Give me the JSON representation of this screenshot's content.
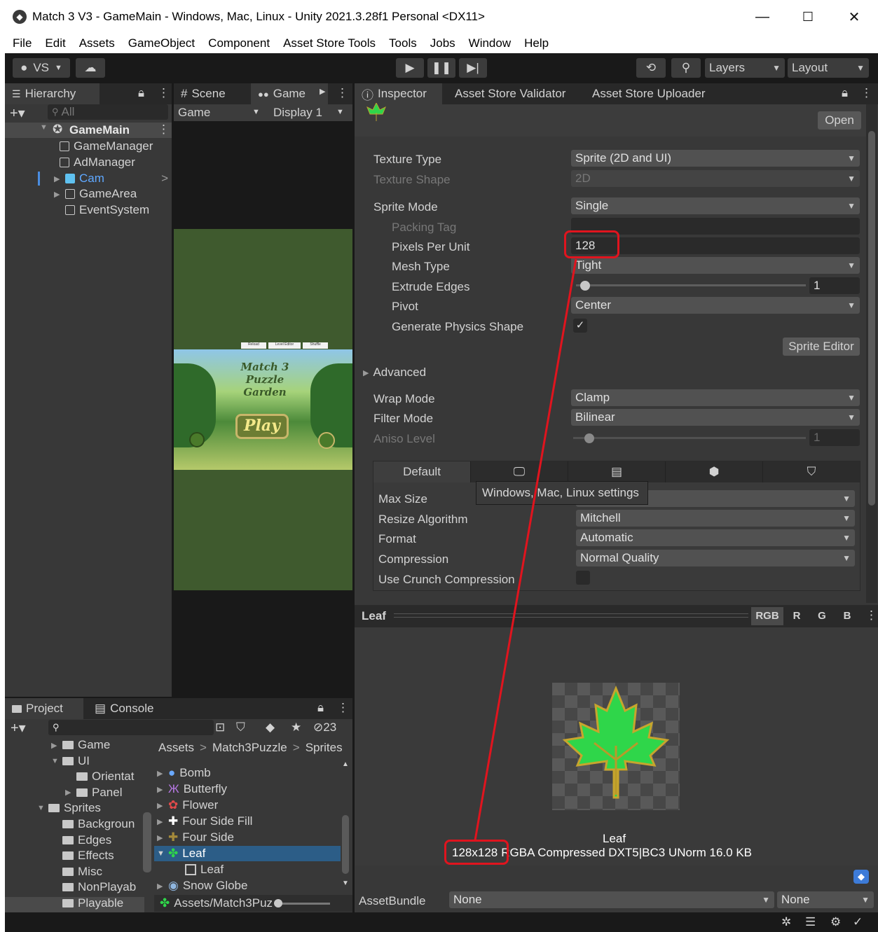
{
  "window": {
    "title": "Match 3 V3 - GameMain - Windows, Mac, Linux - Unity 2021.3.28f1 Personal <DX11>",
    "minimize": "—",
    "maximize": "☐",
    "close": "✕"
  },
  "menu": [
    "File",
    "Edit",
    "Assets",
    "GameObject",
    "Component",
    "Asset Store Tools",
    "Tools",
    "Jobs",
    "Window",
    "Help"
  ],
  "toolbar": {
    "account": "VS",
    "layers": "Layers",
    "layout": "Layout"
  },
  "hierarchy": {
    "tab": "Hierarchy",
    "search_placeholder": "All",
    "scene": "GameMain",
    "items": [
      "GameManager",
      "AdManager",
      "Cam",
      "GameArea",
      "EventSystem"
    ]
  },
  "game": {
    "tab_scene": "Scene",
    "tab_game": "Game",
    "view": "Game",
    "display": "Display 1",
    "buttons": [
      "Reload",
      "Level Editor",
      "Shuffle"
    ],
    "logo": "Match 3 Puzzle Garden",
    "play": "Play"
  },
  "inspector": {
    "tabs": [
      "Inspector",
      "Asset Store Validator",
      "Asset Store Uploader"
    ],
    "open": "Open",
    "props": [
      {
        "label": "Texture Type",
        "value": "Sprite (2D and UI)"
      },
      {
        "label": "Texture Shape",
        "value": "2D"
      },
      {
        "label": "Sprite Mode",
        "value": "Single"
      },
      {
        "label": "Packing Tag",
        "value": ""
      },
      {
        "label": "Pixels Per Unit",
        "value": "128"
      },
      {
        "label": "Mesh Type",
        "value": "Tight"
      },
      {
        "label": "Extrude Edges",
        "value": "1"
      },
      {
        "label": "Pivot",
        "value": "Center"
      },
      {
        "label": "Generate Physics Shape",
        "value": "✓"
      }
    ],
    "sprite_editor": "Sprite Editor",
    "advanced": "Advanced",
    "wrap_mode": {
      "label": "Wrap Mode",
      "value": "Clamp"
    },
    "filter_mode": {
      "label": "Filter Mode",
      "value": "Bilinear"
    },
    "aniso": {
      "label": "Aniso Level",
      "value": "1"
    },
    "platform_default": "Default",
    "tooltip": "Windows, Mac, Linux settings",
    "max_size": "Max Size",
    "resize": {
      "label": "Resize Algorithm",
      "value": "Mitchell"
    },
    "format": {
      "label": "Format",
      "value": "Automatic"
    },
    "compression": {
      "label": "Compression",
      "value": "Normal Quality"
    },
    "crunch": "Use Crunch Compression"
  },
  "preview": {
    "title": "Leaf",
    "channels": [
      "RGB",
      "R",
      "G",
      "B"
    ],
    "name": "Leaf",
    "size": "128x128",
    "info": "RGBA Compressed DXT5|BC3 UNorm  16.0 KB"
  },
  "assetbundle": {
    "label": "AssetBundle",
    "value": "None",
    "variant": "None"
  },
  "project": {
    "tab_project": "Project",
    "tab_console": "Console",
    "hidden_count": "23",
    "tree": [
      {
        "label": "Game",
        "indent": 1,
        "arrow": "▶"
      },
      {
        "label": "UI",
        "indent": 1,
        "arrow": "▼"
      },
      {
        "label": "Orientat",
        "indent": 2,
        "arrow": ""
      },
      {
        "label": "Panel",
        "indent": 2,
        "arrow": "▶"
      },
      {
        "label": "Sprites",
        "indent": 0,
        "arrow": "▼"
      },
      {
        "label": "Backgroun",
        "indent": 1,
        "arrow": ""
      },
      {
        "label": "Edges",
        "indent": 1,
        "arrow": ""
      },
      {
        "label": "Effects",
        "indent": 1,
        "arrow": ""
      },
      {
        "label": "Misc",
        "indent": 1,
        "arrow": ""
      },
      {
        "label": "NonPlayab",
        "indent": 1,
        "arrow": ""
      },
      {
        "label": "Playable",
        "indent": 1,
        "arrow": ""
      }
    ],
    "breadcrumb": [
      "Assets",
      "Match3Puzzle",
      "Sprites"
    ],
    "files": [
      "Bomb",
      "Butterfly",
      "Flower",
      "Four Side Fill",
      "Four Side",
      "Leaf",
      "Leaf",
      "Snow Globe"
    ],
    "path": "Assets/Match3Puz"
  },
  "colors": {
    "red": "#e0141e",
    "leaf": "#2fd64a",
    "selection": "#2c5d87"
  }
}
